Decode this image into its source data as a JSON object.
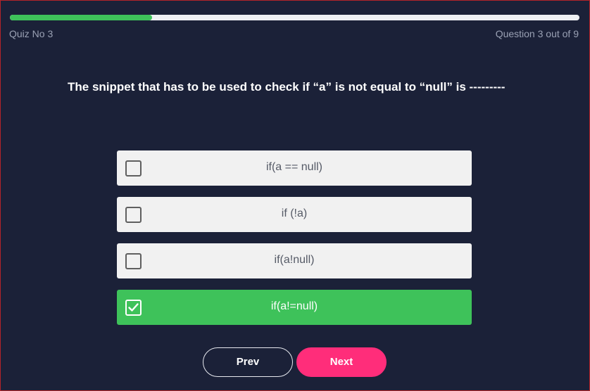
{
  "header": {
    "quiz_label": "Quiz No 3",
    "question_count": "Question 3 out of 9",
    "progress_fraction": 0.25
  },
  "question": {
    "text": "The snippet that has to be used to check if “a” is not equal to “null” is ---------"
  },
  "options": [
    {
      "label": "if(a == null)",
      "selected": false
    },
    {
      "label": "if (!a)",
      "selected": false
    },
    {
      "label": "if(a!null)",
      "selected": false
    },
    {
      "label": "if(a!=null)",
      "selected": true
    }
  ],
  "navigation": {
    "prev_label": "Prev",
    "next_label": "Next"
  },
  "colors": {
    "background": "#1b2138",
    "accent_green": "#3ec25a",
    "next_pink": "#ff2d7a"
  },
  "icons": {
    "checkbox_checked": "checkmark-icon"
  }
}
